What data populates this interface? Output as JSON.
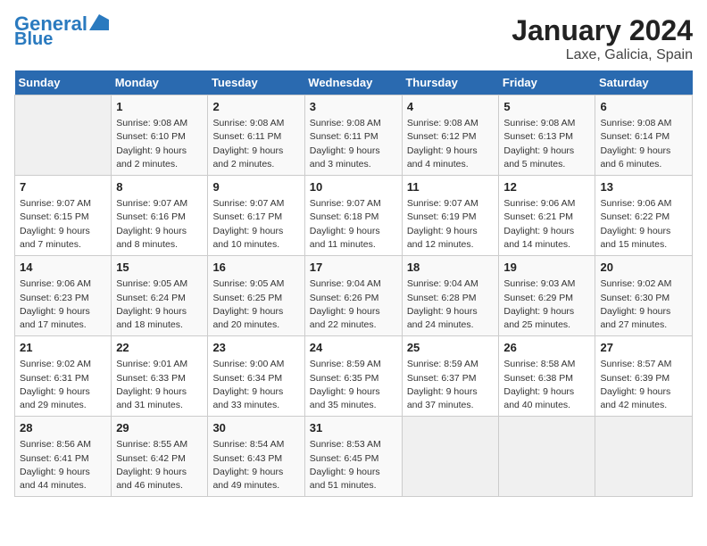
{
  "header": {
    "logo_line1": "General",
    "logo_line2": "Blue",
    "month_year": "January 2024",
    "location": "Laxe, Galicia, Spain"
  },
  "weekdays": [
    "Sunday",
    "Monday",
    "Tuesday",
    "Wednesday",
    "Thursday",
    "Friday",
    "Saturday"
  ],
  "weeks": [
    [
      {
        "day": "",
        "sunrise": "",
        "sunset": "",
        "daylight": ""
      },
      {
        "day": "1",
        "sunrise": "Sunrise: 9:08 AM",
        "sunset": "Sunset: 6:10 PM",
        "daylight": "Daylight: 9 hours and 2 minutes."
      },
      {
        "day": "2",
        "sunrise": "Sunrise: 9:08 AM",
        "sunset": "Sunset: 6:11 PM",
        "daylight": "Daylight: 9 hours and 2 minutes."
      },
      {
        "day": "3",
        "sunrise": "Sunrise: 9:08 AM",
        "sunset": "Sunset: 6:11 PM",
        "daylight": "Daylight: 9 hours and 3 minutes."
      },
      {
        "day": "4",
        "sunrise": "Sunrise: 9:08 AM",
        "sunset": "Sunset: 6:12 PM",
        "daylight": "Daylight: 9 hours and 4 minutes."
      },
      {
        "day": "5",
        "sunrise": "Sunrise: 9:08 AM",
        "sunset": "Sunset: 6:13 PM",
        "daylight": "Daylight: 9 hours and 5 minutes."
      },
      {
        "day": "6",
        "sunrise": "Sunrise: 9:08 AM",
        "sunset": "Sunset: 6:14 PM",
        "daylight": "Daylight: 9 hours and 6 minutes."
      }
    ],
    [
      {
        "day": "7",
        "sunrise": "Sunrise: 9:07 AM",
        "sunset": "Sunset: 6:15 PM",
        "daylight": "Daylight: 9 hours and 7 minutes."
      },
      {
        "day": "8",
        "sunrise": "Sunrise: 9:07 AM",
        "sunset": "Sunset: 6:16 PM",
        "daylight": "Daylight: 9 hours and 8 minutes."
      },
      {
        "day": "9",
        "sunrise": "Sunrise: 9:07 AM",
        "sunset": "Sunset: 6:17 PM",
        "daylight": "Daylight: 9 hours and 10 minutes."
      },
      {
        "day": "10",
        "sunrise": "Sunrise: 9:07 AM",
        "sunset": "Sunset: 6:18 PM",
        "daylight": "Daylight: 9 hours and 11 minutes."
      },
      {
        "day": "11",
        "sunrise": "Sunrise: 9:07 AM",
        "sunset": "Sunset: 6:19 PM",
        "daylight": "Daylight: 9 hours and 12 minutes."
      },
      {
        "day": "12",
        "sunrise": "Sunrise: 9:06 AM",
        "sunset": "Sunset: 6:21 PM",
        "daylight": "Daylight: 9 hours and 14 minutes."
      },
      {
        "day": "13",
        "sunrise": "Sunrise: 9:06 AM",
        "sunset": "Sunset: 6:22 PM",
        "daylight": "Daylight: 9 hours and 15 minutes."
      }
    ],
    [
      {
        "day": "14",
        "sunrise": "Sunrise: 9:06 AM",
        "sunset": "Sunset: 6:23 PM",
        "daylight": "Daylight: 9 hours and 17 minutes."
      },
      {
        "day": "15",
        "sunrise": "Sunrise: 9:05 AM",
        "sunset": "Sunset: 6:24 PM",
        "daylight": "Daylight: 9 hours and 18 minutes."
      },
      {
        "day": "16",
        "sunrise": "Sunrise: 9:05 AM",
        "sunset": "Sunset: 6:25 PM",
        "daylight": "Daylight: 9 hours and 20 minutes."
      },
      {
        "day": "17",
        "sunrise": "Sunrise: 9:04 AM",
        "sunset": "Sunset: 6:26 PM",
        "daylight": "Daylight: 9 hours and 22 minutes."
      },
      {
        "day": "18",
        "sunrise": "Sunrise: 9:04 AM",
        "sunset": "Sunset: 6:28 PM",
        "daylight": "Daylight: 9 hours and 24 minutes."
      },
      {
        "day": "19",
        "sunrise": "Sunrise: 9:03 AM",
        "sunset": "Sunset: 6:29 PM",
        "daylight": "Daylight: 9 hours and 25 minutes."
      },
      {
        "day": "20",
        "sunrise": "Sunrise: 9:02 AM",
        "sunset": "Sunset: 6:30 PM",
        "daylight": "Daylight: 9 hours and 27 minutes."
      }
    ],
    [
      {
        "day": "21",
        "sunrise": "Sunrise: 9:02 AM",
        "sunset": "Sunset: 6:31 PM",
        "daylight": "Daylight: 9 hours and 29 minutes."
      },
      {
        "day": "22",
        "sunrise": "Sunrise: 9:01 AM",
        "sunset": "Sunset: 6:33 PM",
        "daylight": "Daylight: 9 hours and 31 minutes."
      },
      {
        "day": "23",
        "sunrise": "Sunrise: 9:00 AM",
        "sunset": "Sunset: 6:34 PM",
        "daylight": "Daylight: 9 hours and 33 minutes."
      },
      {
        "day": "24",
        "sunrise": "Sunrise: 8:59 AM",
        "sunset": "Sunset: 6:35 PM",
        "daylight": "Daylight: 9 hours and 35 minutes."
      },
      {
        "day": "25",
        "sunrise": "Sunrise: 8:59 AM",
        "sunset": "Sunset: 6:37 PM",
        "daylight": "Daylight: 9 hours and 37 minutes."
      },
      {
        "day": "26",
        "sunrise": "Sunrise: 8:58 AM",
        "sunset": "Sunset: 6:38 PM",
        "daylight": "Daylight: 9 hours and 40 minutes."
      },
      {
        "day": "27",
        "sunrise": "Sunrise: 8:57 AM",
        "sunset": "Sunset: 6:39 PM",
        "daylight": "Daylight: 9 hours and 42 minutes."
      }
    ],
    [
      {
        "day": "28",
        "sunrise": "Sunrise: 8:56 AM",
        "sunset": "Sunset: 6:41 PM",
        "daylight": "Daylight: 9 hours and 44 minutes."
      },
      {
        "day": "29",
        "sunrise": "Sunrise: 8:55 AM",
        "sunset": "Sunset: 6:42 PM",
        "daylight": "Daylight: 9 hours and 46 minutes."
      },
      {
        "day": "30",
        "sunrise": "Sunrise: 8:54 AM",
        "sunset": "Sunset: 6:43 PM",
        "daylight": "Daylight: 9 hours and 49 minutes."
      },
      {
        "day": "31",
        "sunrise": "Sunrise: 8:53 AM",
        "sunset": "Sunset: 6:45 PM",
        "daylight": "Daylight: 9 hours and 51 minutes."
      },
      {
        "day": "",
        "sunrise": "",
        "sunset": "",
        "daylight": ""
      },
      {
        "day": "",
        "sunrise": "",
        "sunset": "",
        "daylight": ""
      },
      {
        "day": "",
        "sunrise": "",
        "sunset": "",
        "daylight": ""
      }
    ]
  ]
}
